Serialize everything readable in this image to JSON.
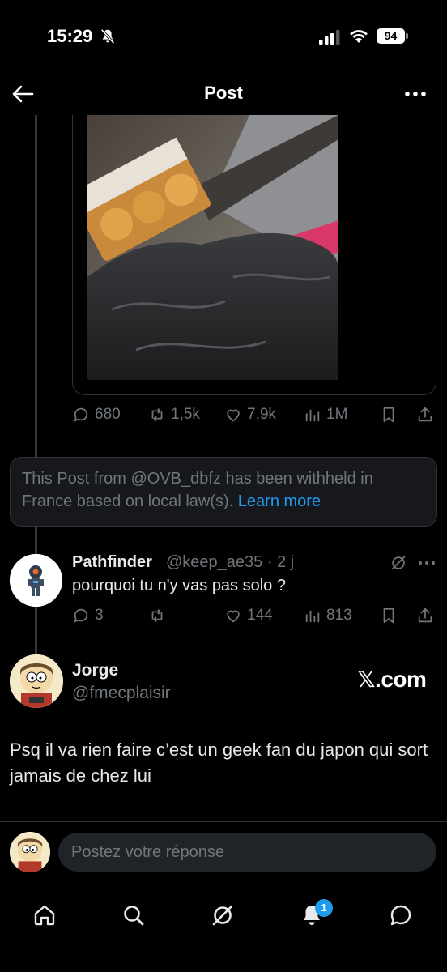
{
  "status_bar": {
    "time": "15:29",
    "battery": "94"
  },
  "header": {
    "title": "Post"
  },
  "main_post": {
    "stats": {
      "replies": "680",
      "reposts": "1,5k",
      "likes": "7,9k",
      "views": "1M"
    }
  },
  "withheld_notice": {
    "text": "This Post from @OVB_dbfz has been withheld in France based on local law(s).",
    "link_label": "Learn more"
  },
  "reply": {
    "name": "Pathfinder",
    "handle": "@keep_ae35 · 2 j",
    "text": "pourquoi tu n'y vas pas solo ?",
    "stats": {
      "replies": "3",
      "reposts": "",
      "likes": "144",
      "views": "813"
    }
  },
  "embedded_reply": {
    "name": "Jorge",
    "handle": "@fmecplaisir",
    "watermark": "𝕏.com",
    "text": "Psq il va rien faire c’est un geek fan du japon qui sort jamais de chez lui"
  },
  "composer": {
    "placeholder": "Postez votre réponse"
  },
  "tabbar": {
    "notification_count": "1"
  },
  "colors": {
    "accent": "#1d9bf0",
    "muted": "#71767b",
    "background": "#000000"
  }
}
